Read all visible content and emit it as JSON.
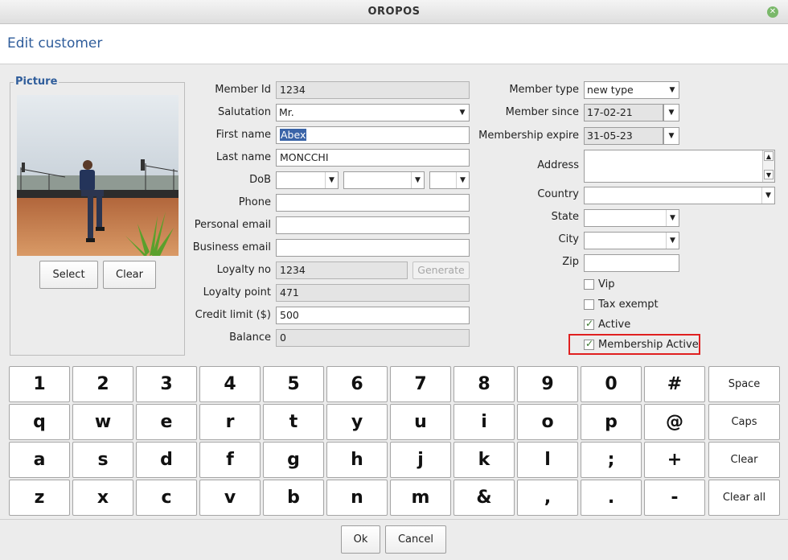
{
  "window": {
    "title": "OROPOS"
  },
  "heading": "Edit customer",
  "picture": {
    "legend": "Picture",
    "select_label": "Select",
    "clear_label": "Clear"
  },
  "form": {
    "member_id": {
      "label": "Member Id",
      "value": "1234"
    },
    "salutation": {
      "label": "Salutation",
      "value": "Mr."
    },
    "first_name": {
      "label": "First name",
      "value": "Abex"
    },
    "last_name": {
      "label": "Last name",
      "value": "MONCCHI"
    },
    "dob": {
      "label": "DoB",
      "day": "",
      "month": "",
      "year": ""
    },
    "phone": {
      "label": "Phone",
      "value": ""
    },
    "personal_email": {
      "label": "Personal email",
      "value": ""
    },
    "business_email": {
      "label": "Business email",
      "value": ""
    },
    "loyalty_no": {
      "label": "Loyalty no",
      "value": "1234",
      "generate_label": "Generate"
    },
    "loyalty_point": {
      "label": "Loyalty point",
      "value": "471"
    },
    "credit_limit": {
      "label": "Credit limit ($)",
      "value": "500"
    },
    "balance": {
      "label": "Balance",
      "value": "0"
    }
  },
  "membership": {
    "member_type": {
      "label": "Member type",
      "value": "new type"
    },
    "member_since": {
      "label": "Member since",
      "value": "17-02-21"
    },
    "membership_expire": {
      "label": "Membership expire",
      "value": "31-05-23"
    },
    "address": {
      "label": "Address",
      "value": ""
    },
    "country": {
      "label": "Country",
      "value": ""
    },
    "state": {
      "label": "State",
      "value": ""
    },
    "city": {
      "label": "City",
      "value": ""
    },
    "zip": {
      "label": "Zip",
      "value": ""
    },
    "vip": {
      "label": "Vip",
      "checked": false
    },
    "tax_exempt": {
      "label": "Tax exempt",
      "checked": false
    },
    "active": {
      "label": "Active",
      "checked": true
    },
    "membership_active": {
      "label": "Membership Active",
      "checked": true
    }
  },
  "keyboard": {
    "rows": [
      [
        "1",
        "2",
        "3",
        "4",
        "5",
        "6",
        "7",
        "8",
        "9",
        "0",
        "#"
      ],
      [
        "q",
        "w",
        "e",
        "r",
        "t",
        "y",
        "u",
        "i",
        "o",
        "p",
        "@"
      ],
      [
        "a",
        "s",
        "d",
        "f",
        "g",
        "h",
        "j",
        "k",
        "l",
        ";",
        "+"
      ],
      [
        "z",
        "x",
        "c",
        "v",
        "b",
        "n",
        "m",
        "&",
        ",",
        ".",
        "-"
      ]
    ],
    "functions": [
      "Space",
      "Caps",
      "Clear",
      "Clear all"
    ]
  },
  "footer": {
    "ok_label": "Ok",
    "cancel_label": "Cancel"
  },
  "colors": {
    "heading": "#2f5d9b",
    "highlight": "#e02020",
    "selection": "#3a64a8"
  },
  "icons": {
    "dropdown": "chevron-down-icon",
    "close": "close-icon",
    "check": "checkmark-icon"
  }
}
